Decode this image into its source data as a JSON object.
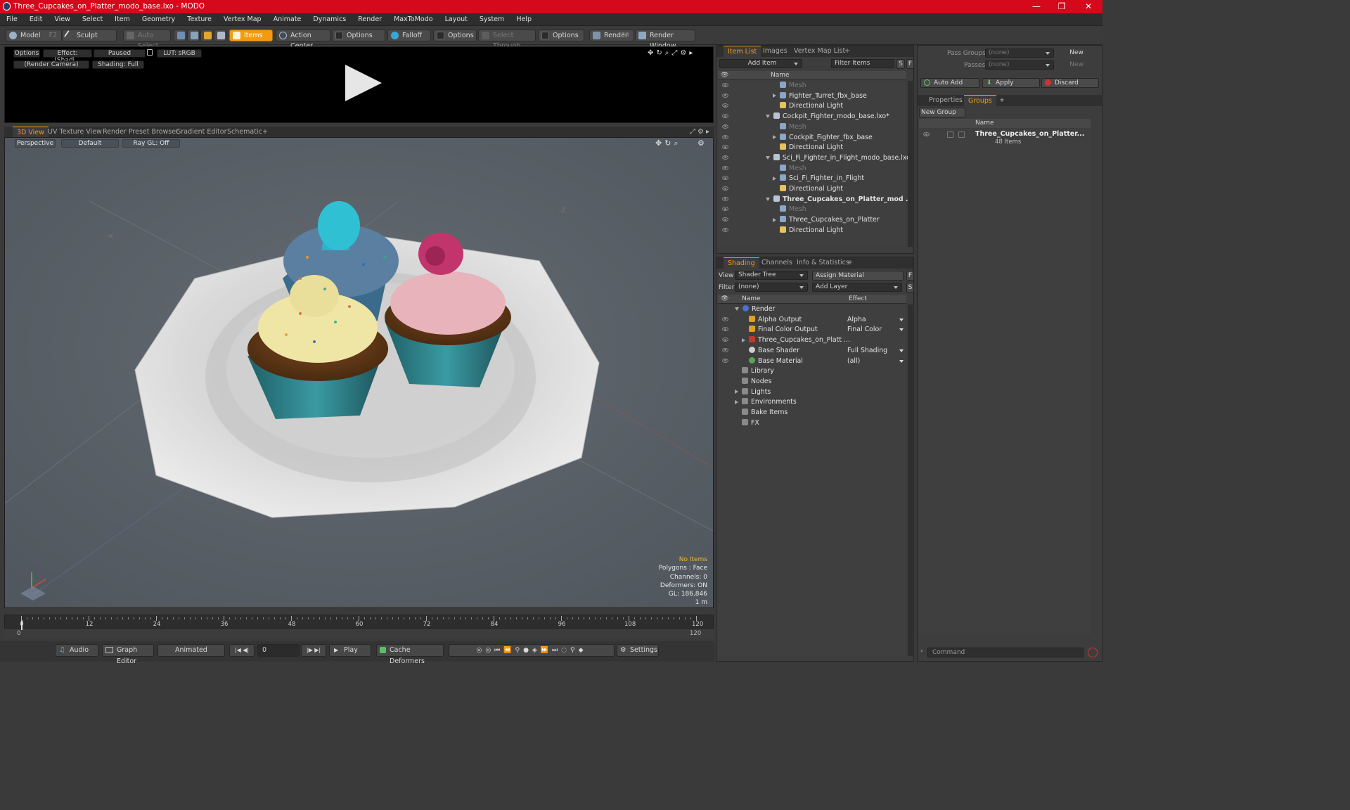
{
  "window": {
    "title": "Three_Cupcakes_on_Platter_modo_base.lxo - MODO",
    "min": "—",
    "max": "❐",
    "close": "✕"
  },
  "menu": [
    "File",
    "Edit",
    "View",
    "Select",
    "Item",
    "Geometry",
    "Texture",
    "Vertex Map",
    "Animate",
    "Dynamics",
    "Render",
    "MaxToModo",
    "Layout",
    "System",
    "Help"
  ],
  "toolbar": {
    "model": "Model",
    "model_key": "F2",
    "sculpt": "Sculpt",
    "auto_select": "Auto Select",
    "items": "Items",
    "action_center": "Action Center",
    "options1": "Options",
    "falloff": "Falloff",
    "options2": "Options",
    "select_through": "Select Through",
    "options3": "Options",
    "render": "Render",
    "render_key": "F9",
    "render_window": "Render Window"
  },
  "preview": {
    "options": "Options",
    "effect": "Effect: (Shadi...",
    "paused": "Paused",
    "lut": "LUT: sRGB",
    "camera": "(Render Camera)",
    "shading": "Shading: Full"
  },
  "viewtabs": [
    "3D View",
    "UV Texture View",
    "Render Preset Browser",
    "Gradient Editor",
    "Schematic",
    "+"
  ],
  "viewport": {
    "projection": "Perspective",
    "style": "Default",
    "raygl": "Ray GL: Off",
    "axis_x": "-X",
    "axis_z": "-Z"
  },
  "vpinfo": {
    "items": "No Items",
    "polygons": "Polygons : Face",
    "channels": "Channels: 0",
    "deformers": "Deformers: ON",
    "gl": "GL: 186,846",
    "scale": "1 m"
  },
  "timeline": {
    "ticks": [
      "0",
      "12",
      "24",
      "36",
      "48",
      "60",
      "72",
      "84",
      "96",
      "108",
      "120"
    ],
    "start": "0",
    "end": "120"
  },
  "transport": {
    "audio": "Audio",
    "graph_editor": "Graph Editor",
    "animated": "Animated",
    "frame": "0",
    "play": "Play",
    "cache": "Cache Deformers",
    "settings": "Settings"
  },
  "itemlist": {
    "tabs": [
      "Item List",
      "Images",
      "Vertex Map List",
      "+"
    ],
    "add_item": "Add Item",
    "filter": "Filter Items",
    "s": "S",
    "f": "F",
    "col_name": "Name",
    "rows": [
      {
        "label": "Mesh",
        "indent": 2,
        "dim": true,
        "exp": ""
      },
      {
        "label": "Fighter_Turret_fbx_base",
        "indent": 2,
        "exp": "r"
      },
      {
        "label": "Directional Light",
        "indent": 2,
        "exp": ""
      },
      {
        "label": "Cockpit_Fighter_modo_base.lxo*",
        "indent": 1,
        "exp": "d"
      },
      {
        "label": "Mesh",
        "indent": 2,
        "dim": true,
        "exp": ""
      },
      {
        "label": "Cockpit_Fighter_fbx_base",
        "indent": 2,
        "exp": "r"
      },
      {
        "label": "Directional Light",
        "indent": 2,
        "exp": ""
      },
      {
        "label": "Sci_Fi_Fighter_in_Flight_modo_base.lxo",
        "indent": 1,
        "exp": "d"
      },
      {
        "label": "Mesh",
        "indent": 2,
        "dim": true,
        "exp": ""
      },
      {
        "label": "Sci_Fi_Fighter_in_Flight",
        "indent": 2,
        "exp": "r"
      },
      {
        "label": "Directional Light",
        "indent": 2,
        "exp": ""
      },
      {
        "label": "Three_Cupcakes_on_Platter_mod ...",
        "indent": 1,
        "exp": "d",
        "bold": true
      },
      {
        "label": "Mesh",
        "indent": 2,
        "dim": true,
        "exp": ""
      },
      {
        "label": "Three_Cupcakes_on_Platter",
        "indent": 2,
        "exp": "r"
      },
      {
        "label": "Directional Light",
        "indent": 2,
        "exp": ""
      }
    ]
  },
  "shading": {
    "tabs": [
      "Shading",
      "Channels",
      "Info & Statistics",
      "+"
    ],
    "view_label": "View",
    "view_value": "Shader Tree",
    "assign": "Assign Material",
    "filter_label": "Filter",
    "filter_value": "(none)",
    "add_layer": "Add Layer",
    "f": "F",
    "s": "S",
    "col_name": "Name",
    "col_effect": "Effect",
    "rows": [
      {
        "label": "Render",
        "effect": "",
        "indent": 0,
        "exp": "d",
        "eye": false
      },
      {
        "label": "Alpha Output",
        "effect": "Alpha",
        "indent": 1,
        "exp": "",
        "eye": true
      },
      {
        "label": "Final Color Output",
        "effect": "Final Color",
        "indent": 1,
        "exp": "",
        "eye": true
      },
      {
        "label": "Three_Cupcakes_on_Platt ...",
        "effect": "",
        "indent": 1,
        "exp": "r",
        "eye": true
      },
      {
        "label": "Base Shader",
        "effect": "Full Shading",
        "indent": 1,
        "exp": "",
        "eye": true
      },
      {
        "label": "Base Material",
        "effect": "(all)",
        "indent": 1,
        "exp": "",
        "eye": true
      },
      {
        "label": "Library",
        "effect": "",
        "indent": 0,
        "exp": "",
        "eye": false
      },
      {
        "label": "Nodes",
        "effect": "",
        "indent": 0,
        "exp": "",
        "eye": false
      },
      {
        "label": "Lights",
        "effect": "",
        "indent": 0,
        "exp": "r",
        "eye": false
      },
      {
        "label": "Environments",
        "effect": "",
        "indent": 0,
        "exp": "r",
        "eye": false
      },
      {
        "label": "Bake Items",
        "effect": "",
        "indent": 0,
        "exp": "",
        "eye": false
      },
      {
        "label": "FX",
        "effect": "",
        "indent": 0,
        "exp": "",
        "eye": false
      }
    ]
  },
  "groups": {
    "pass_groups": "Pass Groups",
    "pass_value": "(none)",
    "passes": "Passes",
    "passes_value": "(none)",
    "new1": "New",
    "new2": "New",
    "auto_add": "Auto Add",
    "apply": "Apply",
    "discard": "Discard",
    "tabs": [
      "Properties",
      "Groups",
      "+"
    ],
    "new_group": "New Group",
    "col_name": "Name",
    "group_name": "Three_Cupcakes_on_Platter...",
    "group_count": "48 Items"
  },
  "command": {
    "placeholder": "Command"
  },
  "colors": {
    "accent": "#f29a10",
    "title_bar": "#d6081b",
    "viewport_bg": "#5b6269"
  }
}
